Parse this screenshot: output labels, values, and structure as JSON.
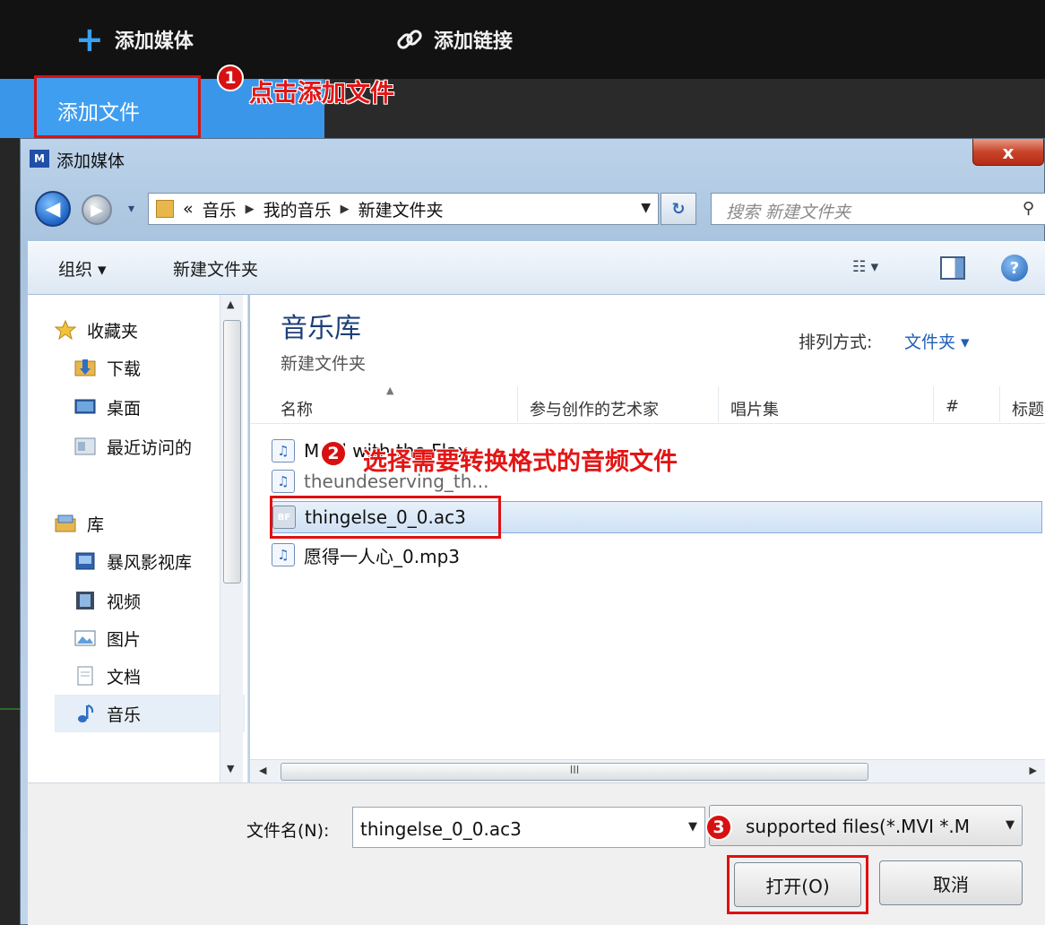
{
  "app": {
    "add_media_label": "添加媒体",
    "add_link_label": "添加链接",
    "add_file_label": "添加文件"
  },
  "annotations": {
    "step1_number": "1",
    "step1_text": "点击添加文件",
    "step2_number": "2",
    "step2_text": "选择需要转换格式的音频文件",
    "step3_number": "3"
  },
  "dialog": {
    "title": "添加媒体",
    "close_label": "x",
    "address": {
      "prefix": "«",
      "segments": [
        "音乐",
        "我的音乐",
        "新建文件夹"
      ]
    },
    "search_placeholder": "搜索 新建文件夹",
    "toolbar": {
      "organize_label": "组织 ▾",
      "new_folder_label": "新建文件夹"
    },
    "nav": {
      "favorites": "收藏夹",
      "downloads": "下载",
      "desktop": "桌面",
      "recent": "最近访问的",
      "library": "库",
      "baofeng": "暴风影视库",
      "videos": "视频",
      "pictures": "图片",
      "documents": "文档",
      "music": "音乐"
    },
    "content": {
      "library_title": "音乐库",
      "library_subtitle": "新建文件夹",
      "arrange_label": "排列方式:",
      "arrange_value": "文件夹 ▾",
      "columns": [
        "名称",
        "参与创作的艺术家",
        "唱片集",
        "#",
        "标题"
      ],
      "files": [
        "Maid with the Flax...",
        "theundeserving_th...",
        "thingelse_0_0.ac3",
        "愿得一人心_0.mp3"
      ],
      "selected_file_index": 2
    },
    "filename_label": "文件名(N):",
    "filename_value": "thingelse_0_0.ac3",
    "filter_value": "supported files(*.MVI *.M",
    "open_label": "打开(O)",
    "cancel_label": "取消"
  },
  "colors": {
    "accent_blue": "#3a96e8",
    "highlight_red": "#e01010"
  }
}
